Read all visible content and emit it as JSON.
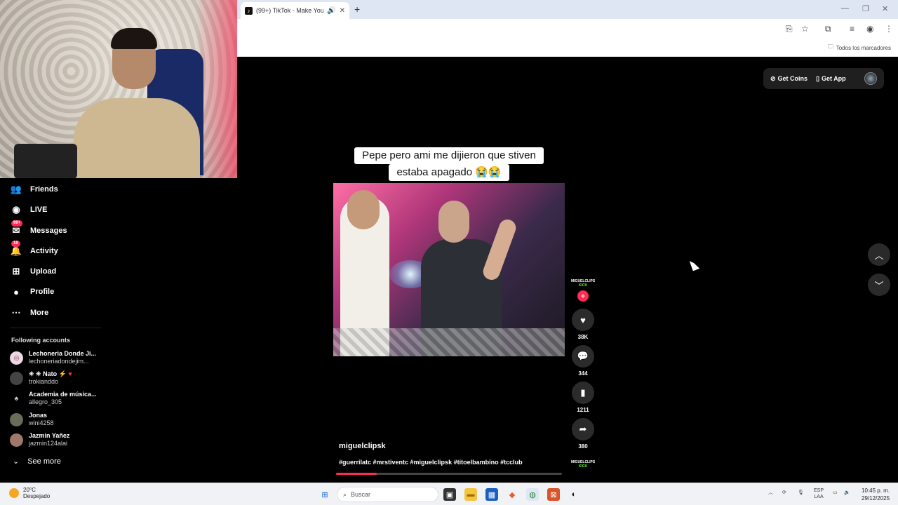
{
  "browser": {
    "tab_title": "(99+) TikTok - Make Your D...",
    "new_tab_label": "+",
    "bookmarks_label": "Todos los marcadores"
  },
  "sidebar": {
    "items": [
      {
        "label": "Friends",
        "icon": "friends-icon"
      },
      {
        "label": "LIVE",
        "icon": "live-icon"
      },
      {
        "label": "Messages",
        "icon": "messages-icon",
        "badge": "99+"
      },
      {
        "label": "Activity",
        "icon": "activity-icon",
        "badge": "19"
      },
      {
        "label": "Upload",
        "icon": "upload-icon"
      },
      {
        "label": "Profile",
        "icon": "profile-icon"
      },
      {
        "label": "More",
        "icon": "more-icon"
      }
    ],
    "following_title": "Following accounts",
    "accounts": [
      {
        "name": "Lechoneria Donde Ji...",
        "username": "lechoneriadondejim..."
      },
      {
        "name": "Nato",
        "username": "trokianddo"
      },
      {
        "name": "Academia de música...",
        "username": "allegro_305"
      },
      {
        "name": "Jonas",
        "username": "wini4258"
      },
      {
        "name": "Jazmin Yañez",
        "username": "jazmin124alai"
      }
    ],
    "see_more": "See more"
  },
  "header": {
    "get_coins": "Get Coins",
    "get_app": "Get App"
  },
  "video": {
    "caption_line1": "Pepe pero ami me dijieron que stiven",
    "caption_line2": "estaba apagado 😭😭",
    "username": "miguelclipsk",
    "hashtags": "#guerrilatc #mrstiventc #miguelclipsk #titoelbambino #tcclub",
    "progress": 0.18,
    "creator_logo_top": "MIGUELCLIPS",
    "creator_logo_bottom": "KICK"
  },
  "actions": {
    "likes": "38K",
    "comments": "344",
    "saves": "1211",
    "shares": "380"
  },
  "taskbar": {
    "temperature": "20°C",
    "weather_desc": "Despejado",
    "search_placeholder": "Buscar",
    "lang_top": "ESP",
    "lang_bottom": "LAA",
    "time": "10:45 p. m.",
    "date": "29/12/2025"
  },
  "colors": {
    "accent": "#fe2c55",
    "kick": "#53fc18",
    "background": "#000000"
  }
}
